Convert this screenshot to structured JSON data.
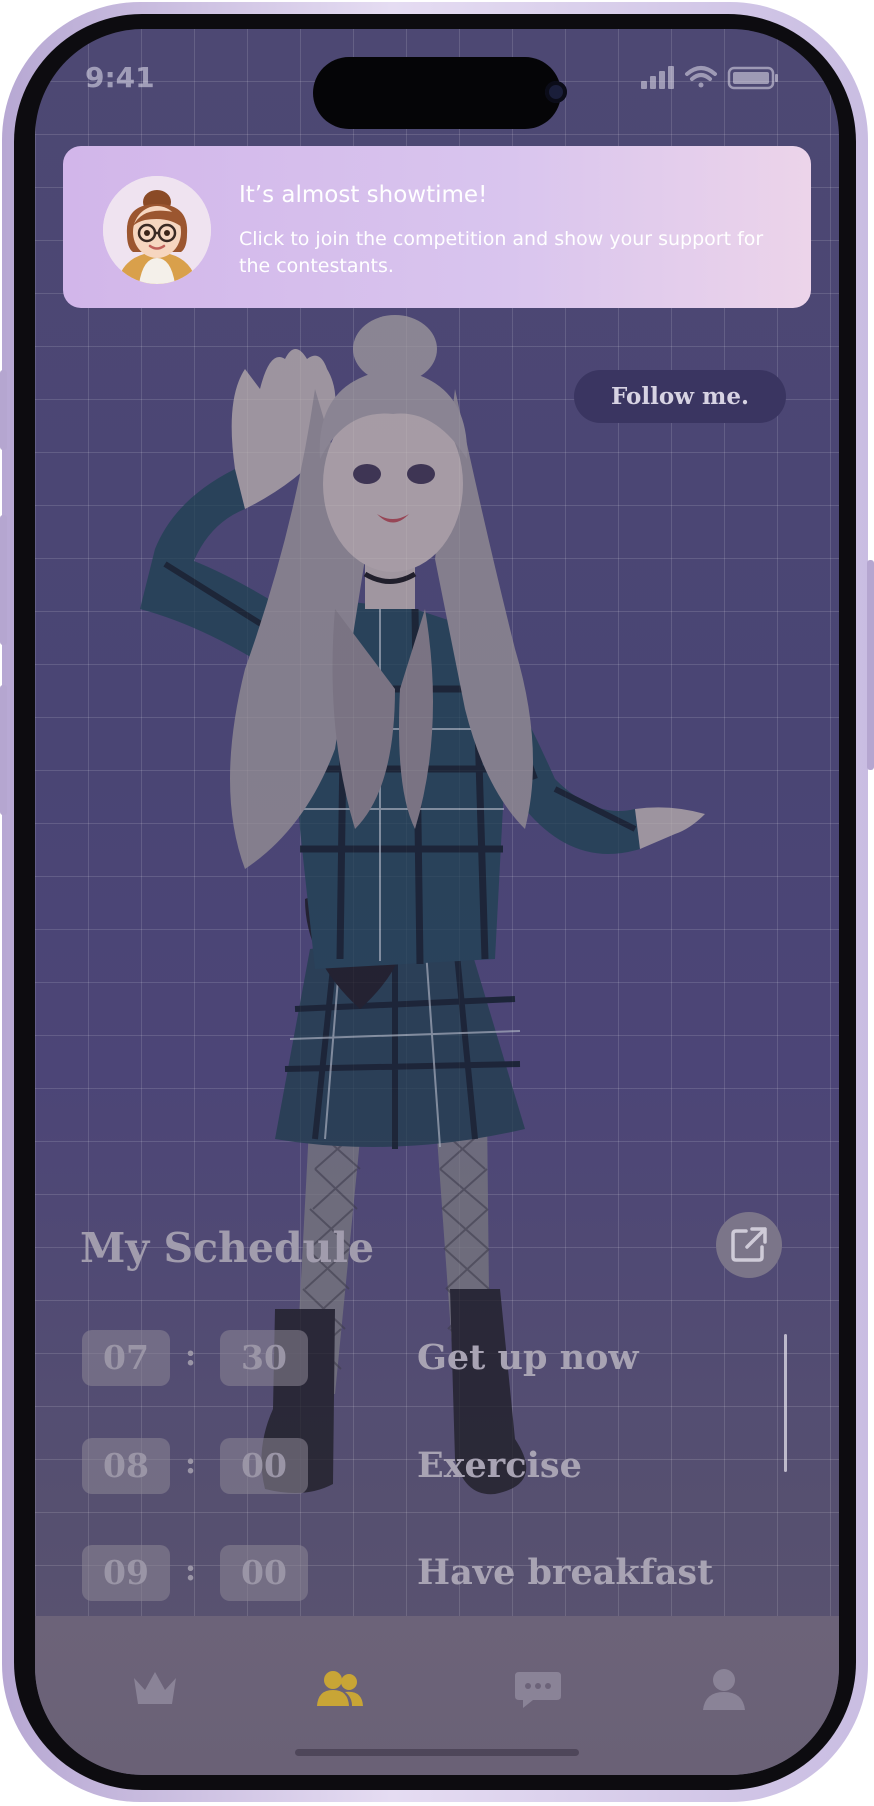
{
  "status_bar": {
    "time": "9:41"
  },
  "notification": {
    "title": "It’s almost showtime!",
    "body": "Click to join the competition and show your support for the contestants."
  },
  "follow_label": "Follow me.",
  "schedule": {
    "title": "My Schedule",
    "items": [
      {
        "hour": "07",
        "minute": "30",
        "task": "Get up now"
      },
      {
        "hour": "08",
        "minute": "00",
        "task": "Exercise"
      },
      {
        "hour": "09",
        "minute": "00",
        "task": "Have breakfast"
      }
    ]
  },
  "tabs": [
    {
      "icon": "crown-icon",
      "active": false
    },
    {
      "icon": "friends-icon",
      "active": true
    },
    {
      "icon": "chat-icon",
      "active": false
    },
    {
      "icon": "profile-icon",
      "active": false
    }
  ],
  "colors": {
    "active_tab": "#c8a536",
    "inactive_tab": "#8a8397",
    "notification_text": "#ffffff"
  }
}
